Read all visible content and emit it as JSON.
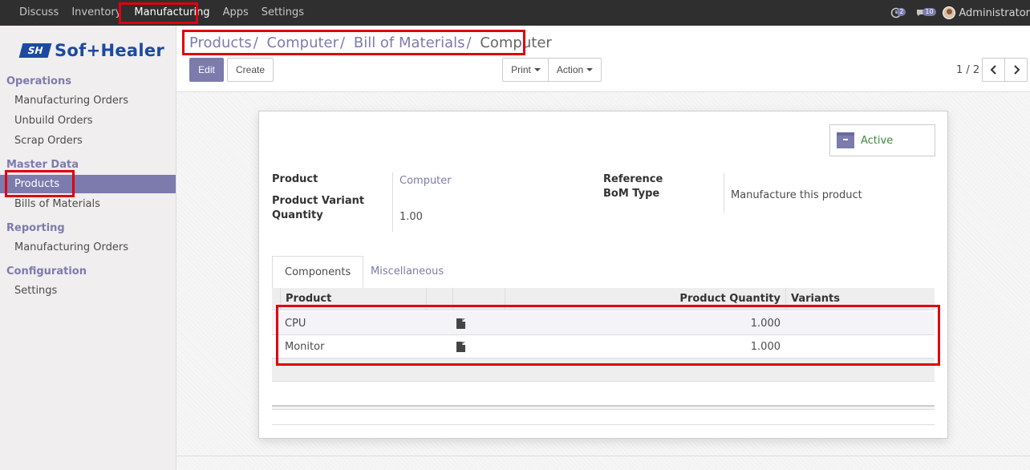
{
  "topbar": {
    "menu": [
      "Discuss",
      "Inventory",
      "Manufacturing",
      "Apps",
      "Settings"
    ],
    "active_menu": "Manufacturing",
    "activity_count": "2",
    "message_count": "10",
    "user_name": "Administrator"
  },
  "sidebar": {
    "logo_text": "Sof+Healer",
    "sections": {
      "operations": "Operations",
      "master_data": "Master Data",
      "reporting": "Reporting",
      "configuration": "Configuration"
    },
    "items": {
      "mo": "Manufacturing Orders",
      "unbuild": "Unbuild Orders",
      "scrap": "Scrap Orders",
      "products": "Products",
      "boms": "Bills of Materials",
      "report_mo": "Manufacturing Orders",
      "settings": "Settings"
    }
  },
  "breadcrumb": {
    "items": [
      "Products",
      "Computer",
      "Bill of Materials",
      "Computer"
    ],
    "separator": "/"
  },
  "toolbar": {
    "edit": "Edit",
    "create": "Create",
    "print": "Print",
    "action": "Action",
    "pager": "1 / 2"
  },
  "form": {
    "status": "Active",
    "labels": {
      "product": "Product",
      "variant": "Product Variant",
      "quantity": "Quantity",
      "reference": "Reference",
      "bom_type": "BoM Type"
    },
    "values": {
      "product": "Computer",
      "quantity": "1.00",
      "bom_type": "Manufacture this product"
    },
    "tabs": [
      "Components",
      "Miscellaneous"
    ],
    "grid": {
      "headers": [
        "Product",
        "Product Quantity",
        "Variants"
      ],
      "rows": [
        {
          "product": "CPU",
          "quantity": "1.000"
        },
        {
          "product": "Monitor",
          "quantity": "1.000"
        }
      ]
    }
  },
  "colors": {
    "accent": "#7c7bad",
    "navbar": "#2f2f2f",
    "highlight": "#e0000f",
    "active_status": "#3e8a3e"
  }
}
